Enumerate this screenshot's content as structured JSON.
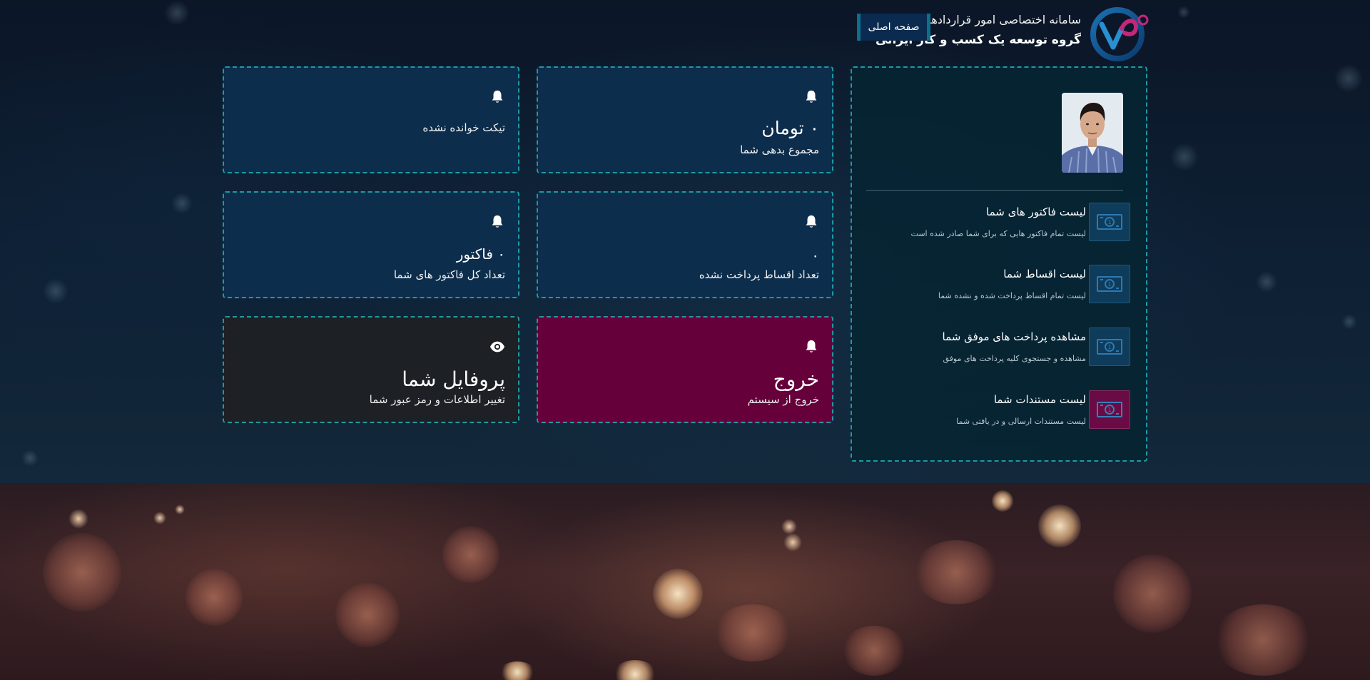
{
  "header": {
    "system_title": "سامانه اختصاصی امور قراردادها",
    "company_name": "گروه توسعه یک کسب و کار ایرانی",
    "home_button_label": "صفحه اصلی",
    "logo_icon": "brand-logo-icon"
  },
  "sidebar": {
    "avatar_icon": "user-photo",
    "items": [
      {
        "title": "لیست فاکتور های شما",
        "description": "لیست تمام فاکتور هایی که برای شما صادر شده است",
        "icon": "banknote-icon"
      },
      {
        "title": "لیست اقساط شما",
        "description": "لیست تمام اقساط پرداخت شده و نشده شما",
        "icon": "banknote-icon"
      },
      {
        "title": "مشاهده پرداخت های موفق شما",
        "description": "مشاهده و جستجوی کلیه پرداخت های موفق",
        "icon": "banknote-icon"
      },
      {
        "title": "لیست مستندات شما",
        "description": "لیست مستندات ارسالی و در یافتی شما",
        "icon": "banknote-icon"
      }
    ]
  },
  "cards": {
    "debt": {
      "value": "۰ تومان",
      "label": "مجموع بدهی شما",
      "icon": "bell-icon"
    },
    "tickets": {
      "value": "",
      "label": "تیکت خوانده نشده",
      "icon": "bell-icon"
    },
    "installments": {
      "value": "۰",
      "label": "تعداد اقساط پرداخت نشده",
      "icon": "bell-icon"
    },
    "invoices": {
      "value": "۰ فاکتور",
      "label": "تعداد کل فاکتور های شما",
      "icon": "bell-icon"
    },
    "exit": {
      "value": "خروج",
      "label": "خروج از سیستم",
      "icon": "bell-icon"
    },
    "profile": {
      "value": "پروفایل شما",
      "label": "تغییر اطلاعات و رمز عبور شما",
      "icon": "eye-icon"
    }
  },
  "colors": {
    "card_bg": "#0c2d4c",
    "card_border": "#1d9aa3",
    "exit_bg": "#65003a",
    "profile_bg": "#1d2025",
    "home_button_bg": "#0b2a4f"
  }
}
